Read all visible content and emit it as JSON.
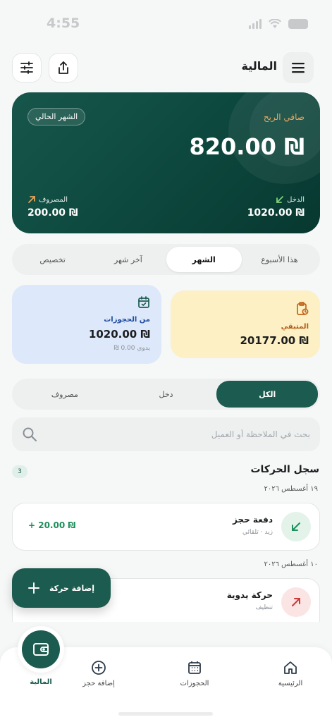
{
  "status_bar": {
    "time": "4:55"
  },
  "header": {
    "title": "المالية",
    "menu_icon": "hamburger-menu-icon",
    "share_icon": "share-upload-icon",
    "filter_icon": "sliders-filter-icon"
  },
  "balance_card": {
    "period_chip": "الشهر الحالي",
    "net_label": "صافي الربح",
    "net_value": "820.00 ₪",
    "income_label": "الدخل",
    "income_value": "1020.00 ₪",
    "expense_label": "المصروف",
    "expense_value": "200.00 ₪",
    "income_color": "#7fd07a",
    "expense_color": "#e3a45a"
  },
  "period_tabs": [
    {
      "label": "هذا الأسبوع",
      "active": false
    },
    {
      "label": "الشهر",
      "active": true
    },
    {
      "label": "آخر شهر",
      "active": false
    },
    {
      "label": "تخصيص",
      "active": false
    }
  ],
  "stats": {
    "remaining": {
      "label": "المتبقي",
      "value": "20177.00 ₪",
      "icon": "clipboard-clock-icon"
    },
    "bookings": {
      "label": "من الحجوزات",
      "value": "1020.00 ₪",
      "sub": "يدوي 0.00 ₪",
      "icon": "calendar-check-icon"
    }
  },
  "type_filter": [
    {
      "label": "الكل",
      "active": true
    },
    {
      "label": "دخل",
      "active": false
    },
    {
      "label": "مصروف",
      "active": false
    }
  ],
  "search": {
    "placeholder": "بحث في الملاحظة أو العميل",
    "value": ""
  },
  "log": {
    "title": "سجل الحركات",
    "count": "3",
    "groups": [
      {
        "date": "١٩ أغسطس ٢٠٢٦",
        "items": [
          {
            "name": "دفعة حجز",
            "sub": "زيد · تلقائي",
            "amount": "+ 20.00 ₪",
            "type": "income"
          }
        ]
      },
      {
        "date": "١٠ أغسطس ٢٠٢٦",
        "items": [
          {
            "name": "حركة يدوية",
            "sub": "تنظيف",
            "amount": "",
            "type": "expense"
          }
        ]
      }
    ]
  },
  "fab": {
    "label": "إضافة حركة"
  },
  "bottom_nav": [
    {
      "label": "الرئيسية",
      "icon": "home-icon"
    },
    {
      "label": "الحجوزات",
      "icon": "calendar-icon"
    },
    {
      "label": "إضافة حجز",
      "icon": "plus-circle-icon"
    },
    {
      "label": "المالية",
      "icon": "wallet-icon",
      "active": true
    }
  ]
}
